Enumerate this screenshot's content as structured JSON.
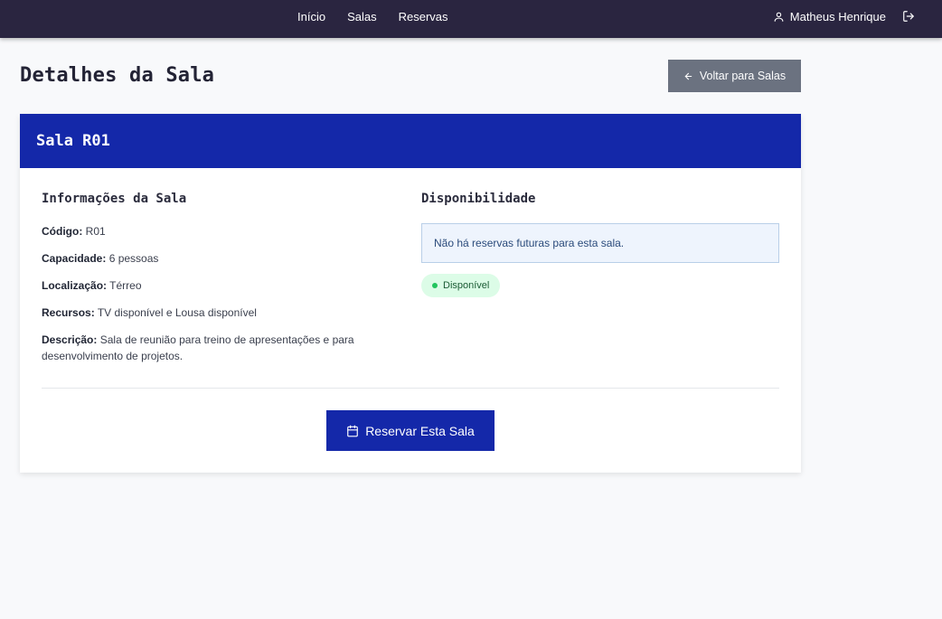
{
  "nav": {
    "links": [
      "Início",
      "Salas",
      "Reservas"
    ],
    "user_name": "Matheus Henrique"
  },
  "page": {
    "title": "Detalhes da Sala",
    "back_label": "Voltar para Salas"
  },
  "room": {
    "title": "Sala R01",
    "info_title": "Informações da Sala",
    "fields": [
      {
        "label": "Código:",
        "value": "R01"
      },
      {
        "label": "Capacidade:",
        "value": "6 pessoas"
      },
      {
        "label": "Localização:",
        "value": "Térreo"
      },
      {
        "label": "Recursos:",
        "value": "TV disponível e Lousa disponível"
      },
      {
        "label": "Descrição:",
        "value": "Sala de reunião para treino de apresentações e para desenvolvimento de projetos."
      }
    ],
    "availability_title": "Disponibilidade",
    "availability_message": "Não há reservas futuras para esta sala.",
    "status": "Disponível",
    "reserve_label": "Reservar Esta Sala"
  },
  "colors": {
    "navbar": "#2a2540",
    "primary": "#1428a9",
    "secondary_button": "#6b7280",
    "status_green": "#22c55e"
  },
  "icons": {
    "user": "user-icon",
    "logout": "logout-icon",
    "back": "arrow-left-icon",
    "calendar": "calendar-icon"
  }
}
